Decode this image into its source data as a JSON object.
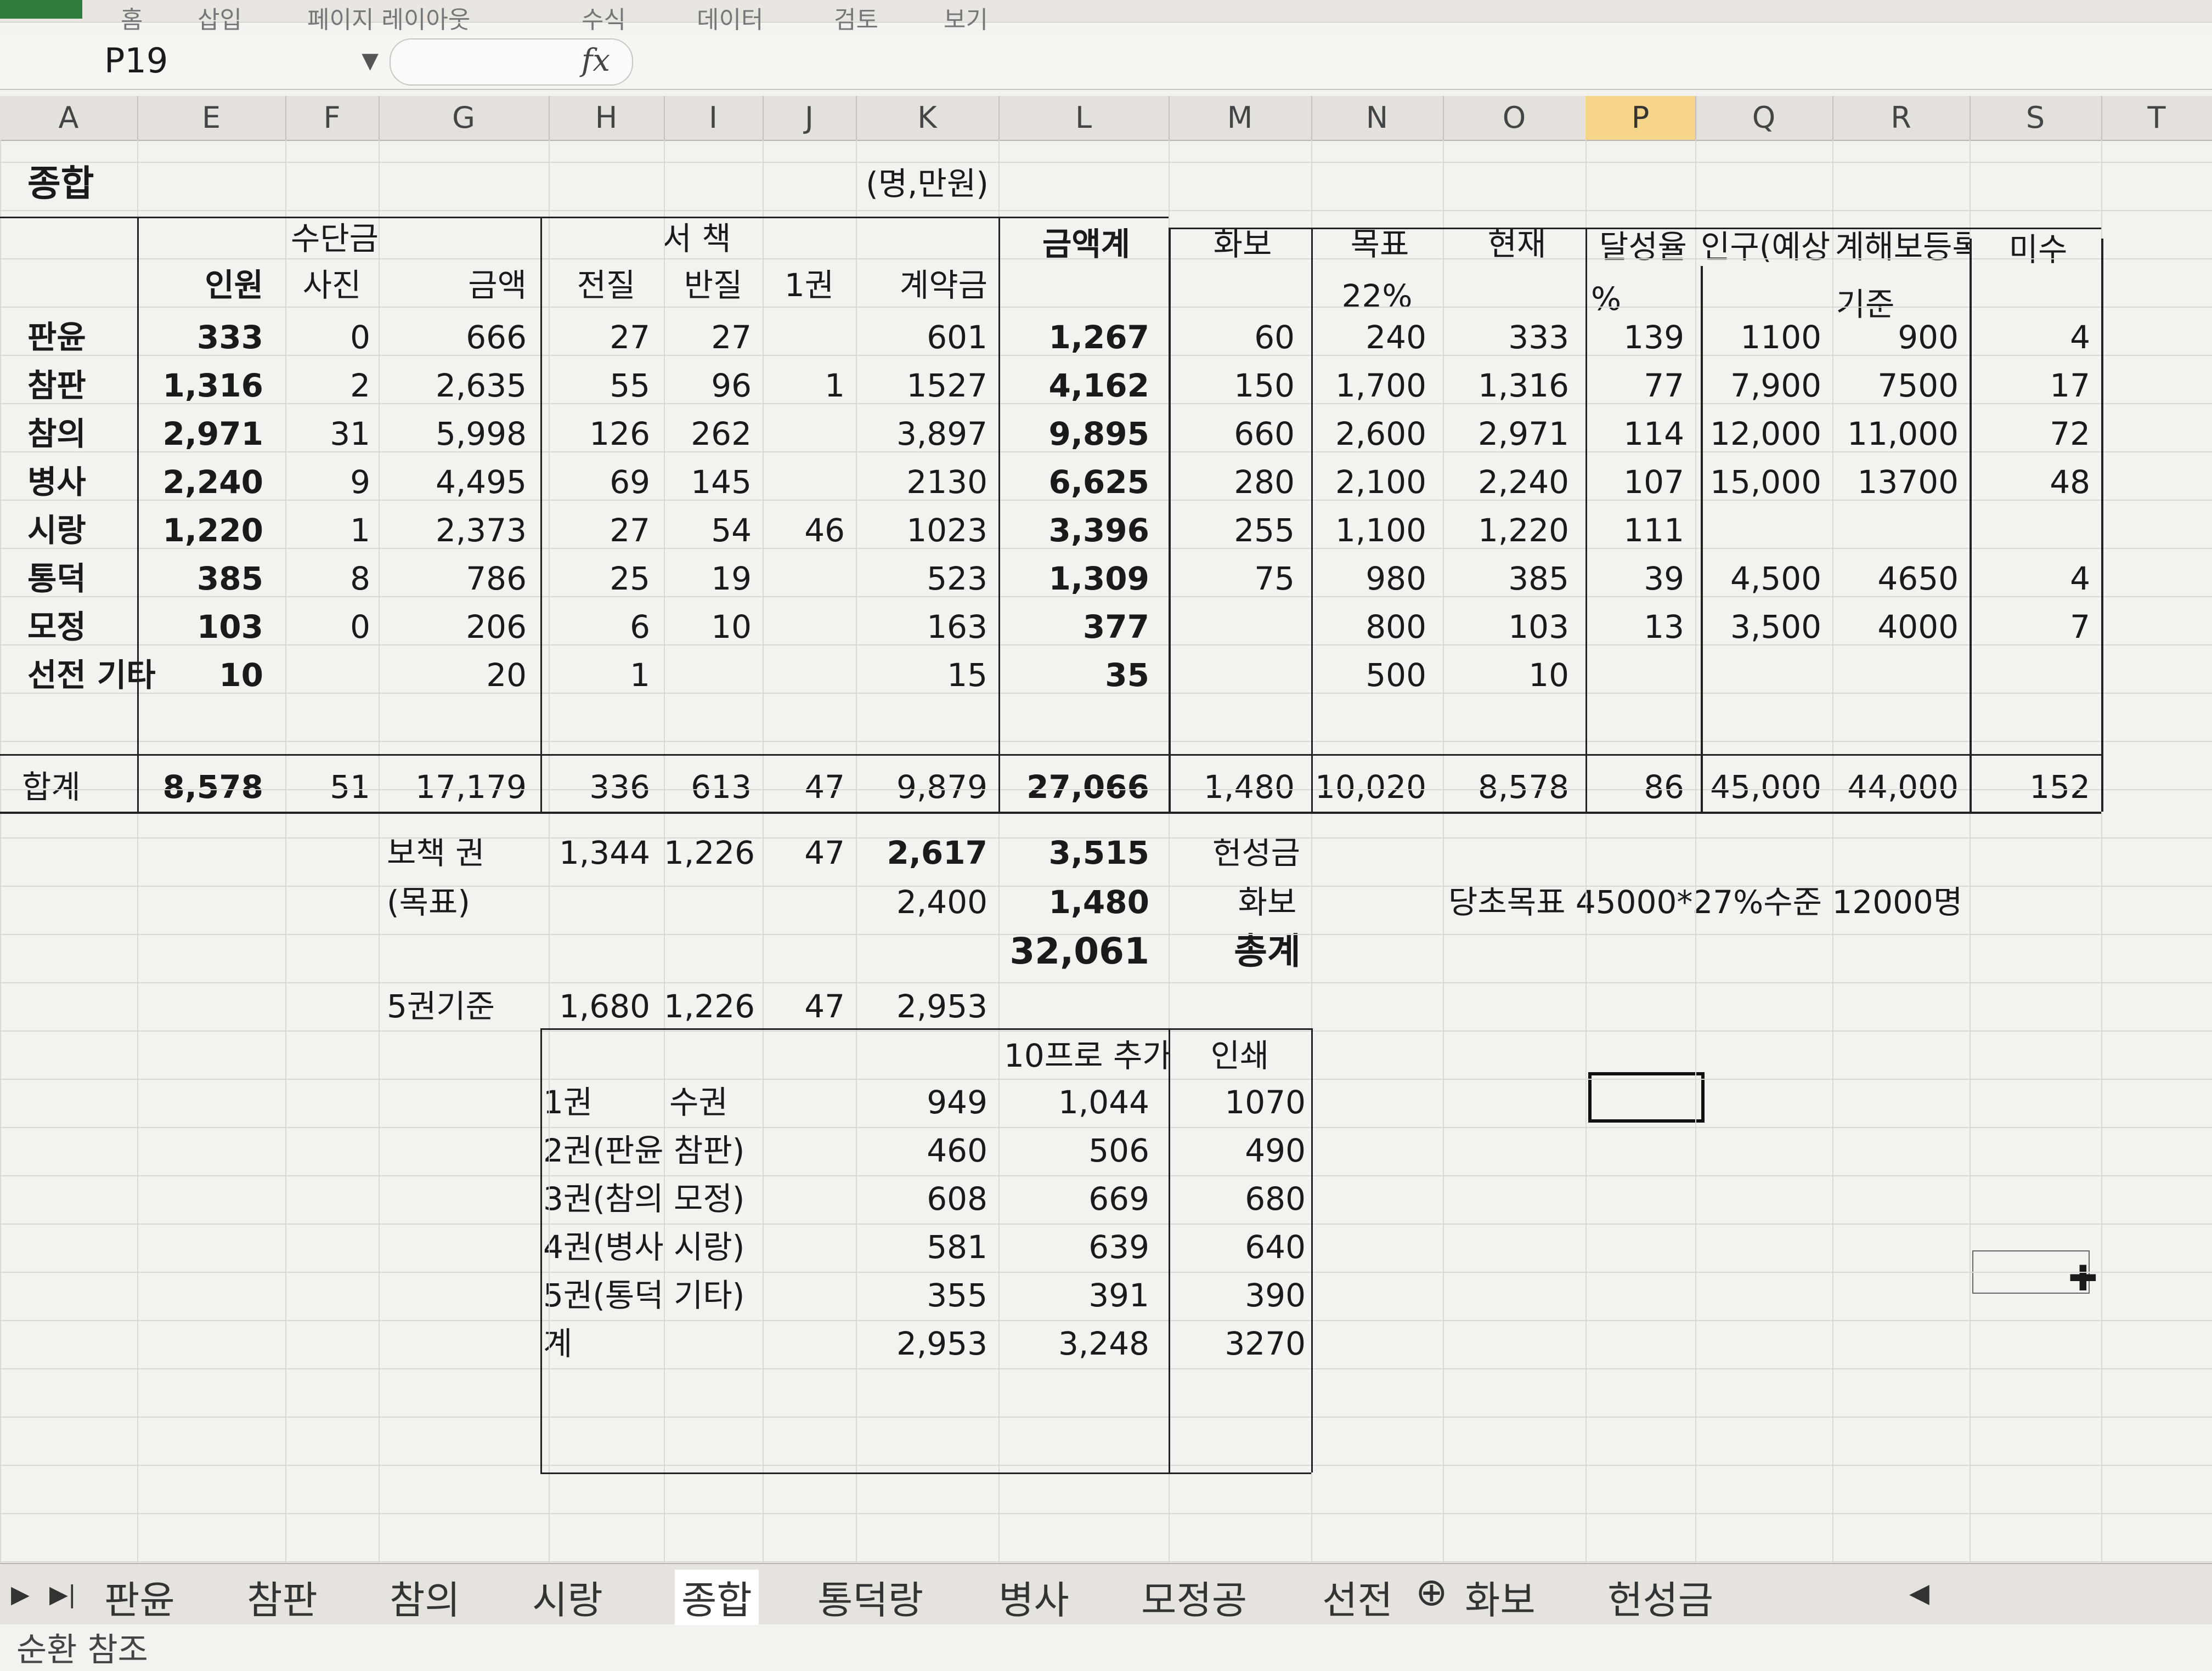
{
  "ribbon": {
    "tabs": [
      "홈",
      "삽입",
      "페이지 레이아웃",
      "수식",
      "데이터",
      "검토",
      "보기"
    ]
  },
  "formula_bar": {
    "cell_ref": "P19",
    "fx": "fx",
    "content": ""
  },
  "columns": [
    "A",
    "E",
    "F",
    "G",
    "H",
    "I",
    "J",
    "K",
    "L",
    "M",
    "N",
    "O",
    "P",
    "Q",
    "R",
    "S",
    "T"
  ],
  "selected_column": "P",
  "title": {
    "name": "종합",
    "unit": "(명,만원)"
  },
  "headers": {
    "sudan": "수단금",
    "inwon": "인원",
    "sajin": "사진",
    "geumaek": "금액",
    "seochaek": "서 책",
    "jeonjil": "전질",
    "banjil": "반질",
    "ilgwon": "1권",
    "gyeyakgeum": "계약금",
    "geumaekgye": "금액계",
    "hwabo": "화보",
    "mokpyo": "목표",
    "mokpyo_pct": "22%",
    "hyeonjae": "현재",
    "dalseongyul": "달성율",
    "pct": "%",
    "ingu": "인구(예상)",
    "gyehae": "계해보등록",
    "gijun": "기준",
    "misu": "미수"
  },
  "rows": [
    {
      "name": "판윤",
      "E": "333",
      "F": "0",
      "G": "666",
      "H": "27",
      "I": "27",
      "J": "",
      "K": "601",
      "L": "1,267",
      "M": "60",
      "N": "240",
      "O": "333",
      "P": "139",
      "Q": "1100",
      "R": "900",
      "S": "4"
    },
    {
      "name": "참판",
      "E": "1,316",
      "F": "2",
      "G": "2,635",
      "H": "55",
      "I": "96",
      "J": "1",
      "K": "1527",
      "L": "4,162",
      "M": "150",
      "N": "1,700",
      "O": "1,316",
      "P": "77",
      "Q": "7,900",
      "R": "7500",
      "S": "17"
    },
    {
      "name": "참의",
      "E": "2,971",
      "F": "31",
      "G": "5,998",
      "H": "126",
      "I": "262",
      "J": "",
      "K": "3,897",
      "L": "9,895",
      "M": "660",
      "N": "2,600",
      "O": "2,971",
      "P": "114",
      "Q": "12,000",
      "R": "11,000",
      "S": "72"
    },
    {
      "name": "병사",
      "E": "2,240",
      "F": "9",
      "G": "4,495",
      "H": "69",
      "I": "145",
      "J": "",
      "K": "2130",
      "L": "6,625",
      "M": "280",
      "N": "2,100",
      "O": "2,240",
      "P": "107",
      "Q": "15,000",
      "R": "13700",
      "S": "48"
    },
    {
      "name": "시랑",
      "E": "1,220",
      "F": "1",
      "G": "2,373",
      "H": "27",
      "I": "54",
      "J": "46",
      "K": "1023",
      "L": "3,396",
      "M": "255",
      "N": "1,100",
      "O": "1,220",
      "P": "111",
      "Q": "",
      "R": "",
      "S": ""
    },
    {
      "name": "통덕",
      "E": "385",
      "F": "8",
      "G": "786",
      "H": "25",
      "I": "19",
      "J": "",
      "K": "523",
      "L": "1,309",
      "M": "75",
      "N": "980",
      "O": "385",
      "P": "39",
      "Q": "4,500",
      "R": "4650",
      "S": "4"
    },
    {
      "name": "모정",
      "E": "103",
      "F": "0",
      "G": "206",
      "H": "6",
      "I": "10",
      "J": "",
      "K": "163",
      "L": "377",
      "M": "",
      "N": "800",
      "O": "103",
      "P": "13",
      "Q": "3,500",
      "R": "4000",
      "S": "7"
    },
    {
      "name": "선전 기타",
      "E": "10",
      "F": "",
      "G": "20",
      "H": "1",
      "I": "",
      "J": "",
      "K": "15",
      "L": "35",
      "M": "",
      "N": "500",
      "O": "10",
      "P": "",
      "Q": "",
      "R": "",
      "S": ""
    }
  ],
  "total": {
    "name": "합계",
    "E": "8,578",
    "F": "51",
    "G": "17,179",
    "H": "336",
    "I": "613",
    "J": "47",
    "K": "9,879",
    "L": "27,066",
    "M": "1,480",
    "N": "10,020",
    "O": "8,578",
    "P": "86",
    "Q": "45,000",
    "R": "44,000",
    "S": "152"
  },
  "summary": {
    "bochaek_label": "보책 권",
    "bochaek_H": "1,344",
    "bochaek_I": "1,226",
    "bochaek_J": "47",
    "bochaek_K": "2,617",
    "bochaek_L": "3,515",
    "hyeonseong": "헌성금",
    "target_label": "(목표)",
    "target_K": "2,400",
    "target_L": "1,480",
    "hwabo": "화보",
    "note": "당초목표 45000*27%수준 12000명",
    "grand_total": "32,061",
    "grand_label": "총계",
    "gijun5_label": "5권기준",
    "gijun5_H": "1,680",
    "gijun5_I": "1,226",
    "gijun5_J": "47",
    "gijun5_K": "2,953"
  },
  "sub_table": {
    "headers": {
      "plus10": "10프로 추가",
      "print": "인쇄"
    },
    "rows": [
      {
        "label": "1권",
        "label2": "수권",
        "k": "949",
        "l": "1,044",
        "m": "1070"
      },
      {
        "label": "2권(판윤 참판)",
        "label2": "",
        "k": "460",
        "l": "506",
        "m": "490"
      },
      {
        "label": "3권(참의 모정)",
        "label2": "",
        "k": "608",
        "l": "669",
        "m": "680"
      },
      {
        "label": "4권(병사 시랑)",
        "label2": "",
        "k": "581",
        "l": "639",
        "m": "640"
      },
      {
        "label": "5권(통덕 기타)",
        "label2": "",
        "k": "355",
        "l": "391",
        "m": "390"
      },
      {
        "label": "계",
        "label2": "",
        "k": "2,953",
        "l": "3,248",
        "m": "3270"
      }
    ]
  },
  "sheet_tabs": [
    "판윤",
    "참판",
    "참의",
    "시랑",
    "종합",
    "통덕랑",
    "병사",
    "모정공",
    "선전",
    "화보",
    "헌성금"
  ],
  "active_sheet": "종합",
  "status": "순환 참조"
}
